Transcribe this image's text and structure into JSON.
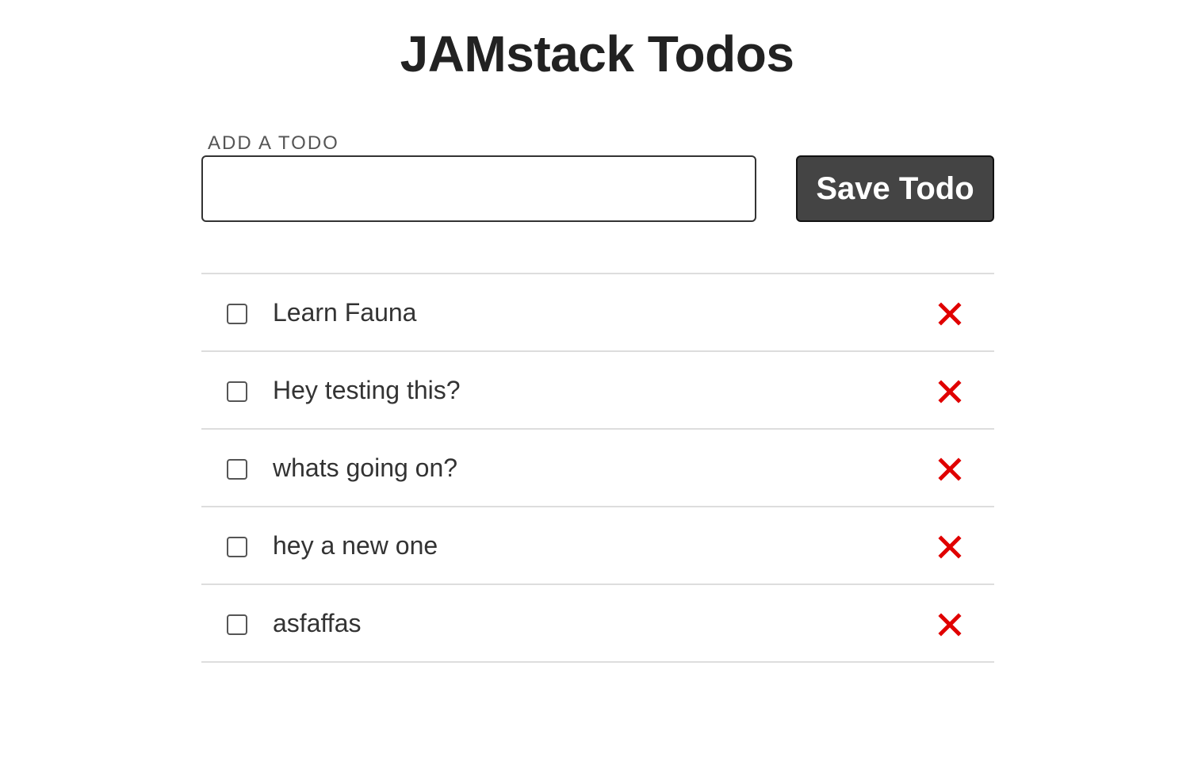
{
  "page": {
    "title": "JAMstack Todos"
  },
  "form": {
    "label": "ADD A TODO",
    "input_value": "",
    "input_placeholder": "",
    "save_label": "Save Todo"
  },
  "todos": [
    {
      "text": "Learn Fauna",
      "completed": false,
      "delete_icon": "close-icon"
    },
    {
      "text": "Hey testing this?",
      "completed": false,
      "delete_icon": "close-icon"
    },
    {
      "text": "whats going on?",
      "completed": false,
      "delete_icon": "close-icon"
    },
    {
      "text": "hey a new one",
      "completed": false,
      "delete_icon": "close-icon"
    },
    {
      "text": "asfaffas",
      "completed": false,
      "delete_icon": "close-icon"
    }
  ],
  "colors": {
    "delete_icon": "#e00000",
    "button_background": "#444444",
    "divider": "#dddddd"
  }
}
